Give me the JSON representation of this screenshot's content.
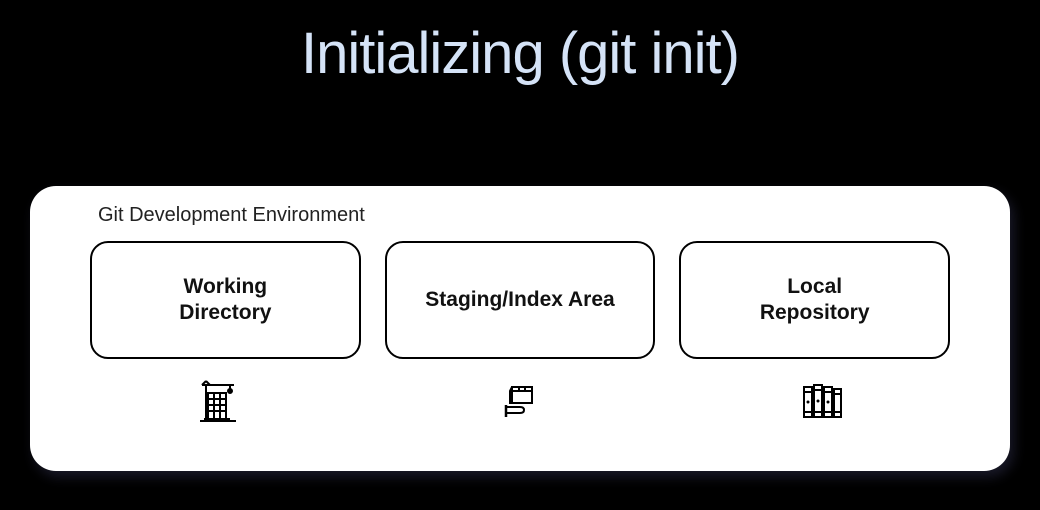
{
  "title": "Initializing (git init)",
  "panel": {
    "header": "Git Development Environment",
    "boxes": [
      {
        "label": "Working\nDirectory",
        "icon": "construction-crane-icon"
      },
      {
        "label": "Staging/Index Area",
        "icon": "hand-box-icon"
      },
      {
        "label": "Local\nRepository",
        "icon": "books-icon"
      }
    ]
  }
}
